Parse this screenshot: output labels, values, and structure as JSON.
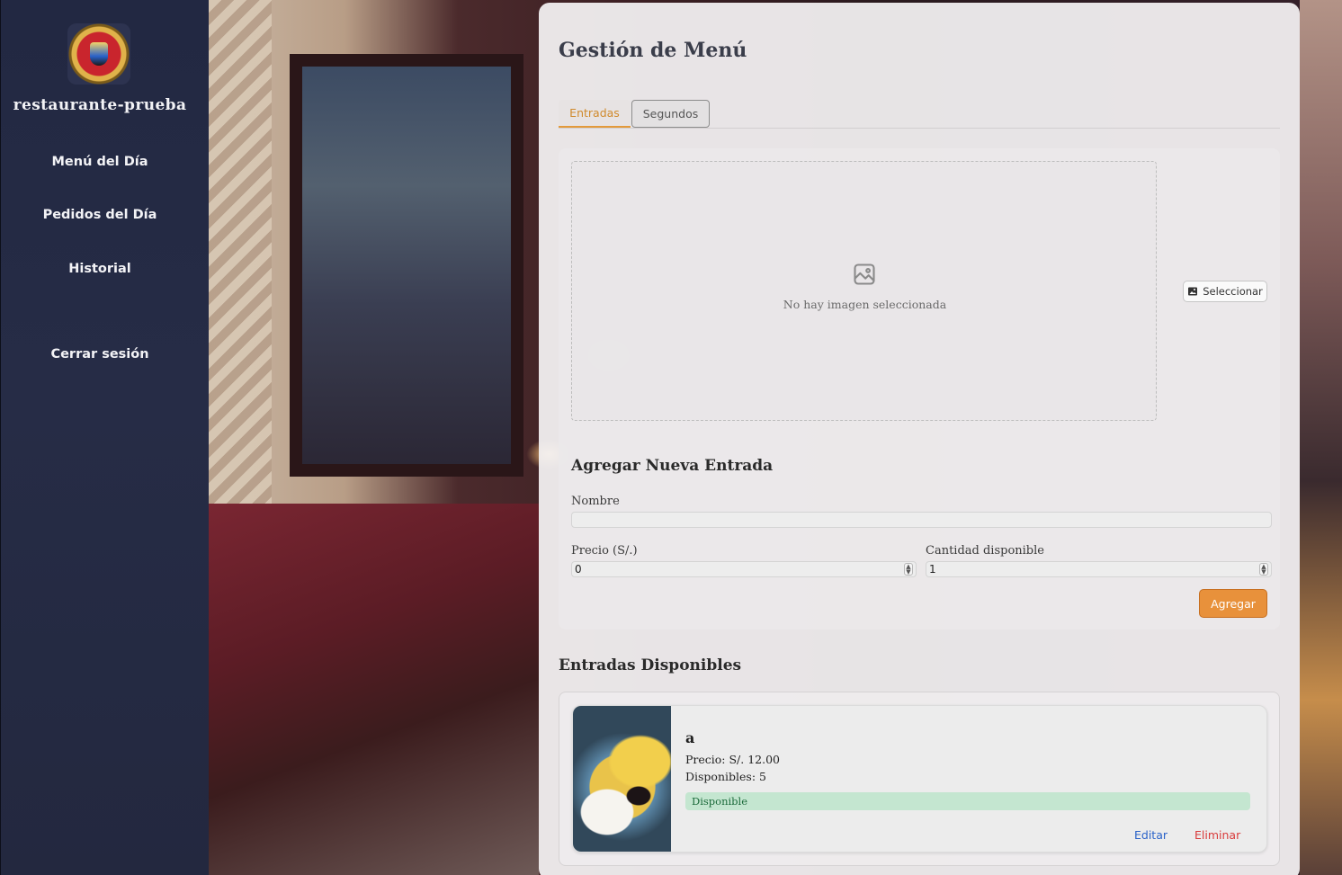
{
  "sidebar": {
    "brand": "restaurante-prueba",
    "logo_icon": "restaurant-crest",
    "items": [
      {
        "label": "Menú del Día"
      },
      {
        "label": "Pedidos del Día"
      },
      {
        "label": "Historial"
      }
    ],
    "logout_label": "Cerrar sesión"
  },
  "main": {
    "title": "Gestión de Menú",
    "tabs": [
      {
        "label": "Entradas",
        "active": true
      },
      {
        "label": "Segundos",
        "active": false
      }
    ],
    "image_upload": {
      "empty_text": "No hay imagen seleccionada",
      "icon": "image-icon",
      "select_label": "Seleccionar"
    },
    "form": {
      "title": "Agregar Nueva Entrada",
      "name_label": "Nombre",
      "name_value": "",
      "price_label": "Precio (S/.)",
      "price_value": "0",
      "quantity_label": "Cantidad disponible",
      "quantity_value": "1",
      "submit_label": "Agregar"
    },
    "list": {
      "title": "Entradas Disponibles",
      "items": [
        {
          "name": "a",
          "price_text": "Precio: S/. 12.00",
          "available_text": "Disponibles: 5",
          "status": "Disponible",
          "edit_label": "Editar",
          "delete_label": "Eliminar"
        }
      ]
    }
  },
  "colors": {
    "sidebar_bg": "#23283f",
    "accent": "#e8913b",
    "available_badge": "#c4e6d0",
    "edit": "#2b63c9",
    "delete": "#d93b3b"
  }
}
